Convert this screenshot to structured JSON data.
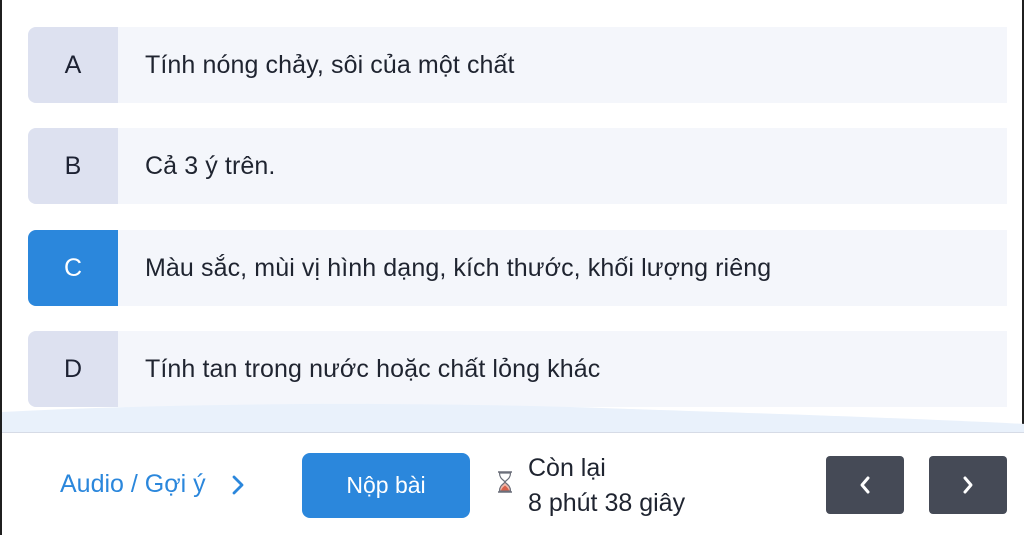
{
  "options": [
    {
      "letter": "A",
      "text": "Tính nóng chảy, sôi của một chất",
      "selected": false
    },
    {
      "letter": "B",
      "text": "Cả 3 ý trên.",
      "selected": false
    },
    {
      "letter": "C",
      "text": "Màu sắc, mùi vị hình dạng, kích thước, khối lượng riêng",
      "selected": true
    },
    {
      "letter": "D",
      "text": "Tính tan trong nước hoặc chất lỏng khác",
      "selected": false
    }
  ],
  "footer": {
    "audio_hint_label": "Audio / Gợi ý",
    "submit_label": "Nộp bài",
    "timer_label": "Còn lại",
    "timer_value": "8 phút 38 giây",
    "prev_icon": "chevron-left-icon",
    "next_icon": "chevron-right-icon"
  },
  "colors": {
    "accent": "#2b87dc",
    "option_bg": "#f4f6fb",
    "letter_bg": "#dde1f0",
    "nav_bg": "#454a56"
  }
}
